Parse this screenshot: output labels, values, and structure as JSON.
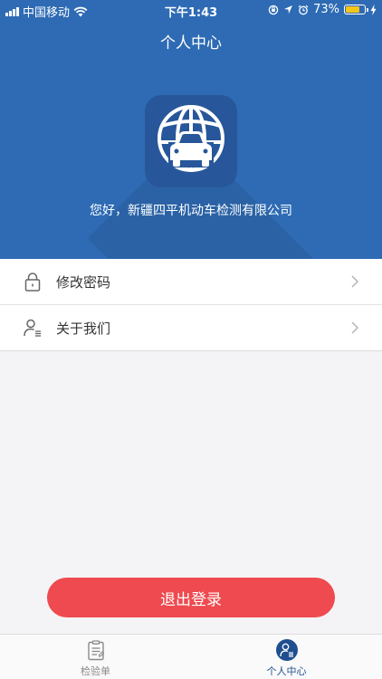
{
  "status_bar": {
    "carrier": "中国移动",
    "time": "下午1:43",
    "battery_percent_text": "73%",
    "battery_level": 0.73
  },
  "header": {
    "title": "个人中心",
    "greeting": "您好，新疆四平机动车检测有限公司"
  },
  "menu": {
    "items": [
      {
        "label": "修改密码",
        "icon": "lock-icon"
      },
      {
        "label": "关于我们",
        "icon": "user-info-icon"
      }
    ]
  },
  "logout": {
    "label": "退出登录"
  },
  "tabbar": {
    "tabs": [
      {
        "label": "检验单",
        "icon": "clipboard-icon",
        "active": false
      },
      {
        "label": "个人中心",
        "icon": "profile-icon",
        "active": true
      }
    ]
  },
  "colors": {
    "header_blue": "#2e6bb4",
    "logout_red": "#ee4a4f",
    "active_tab": "#1f4f8f"
  }
}
